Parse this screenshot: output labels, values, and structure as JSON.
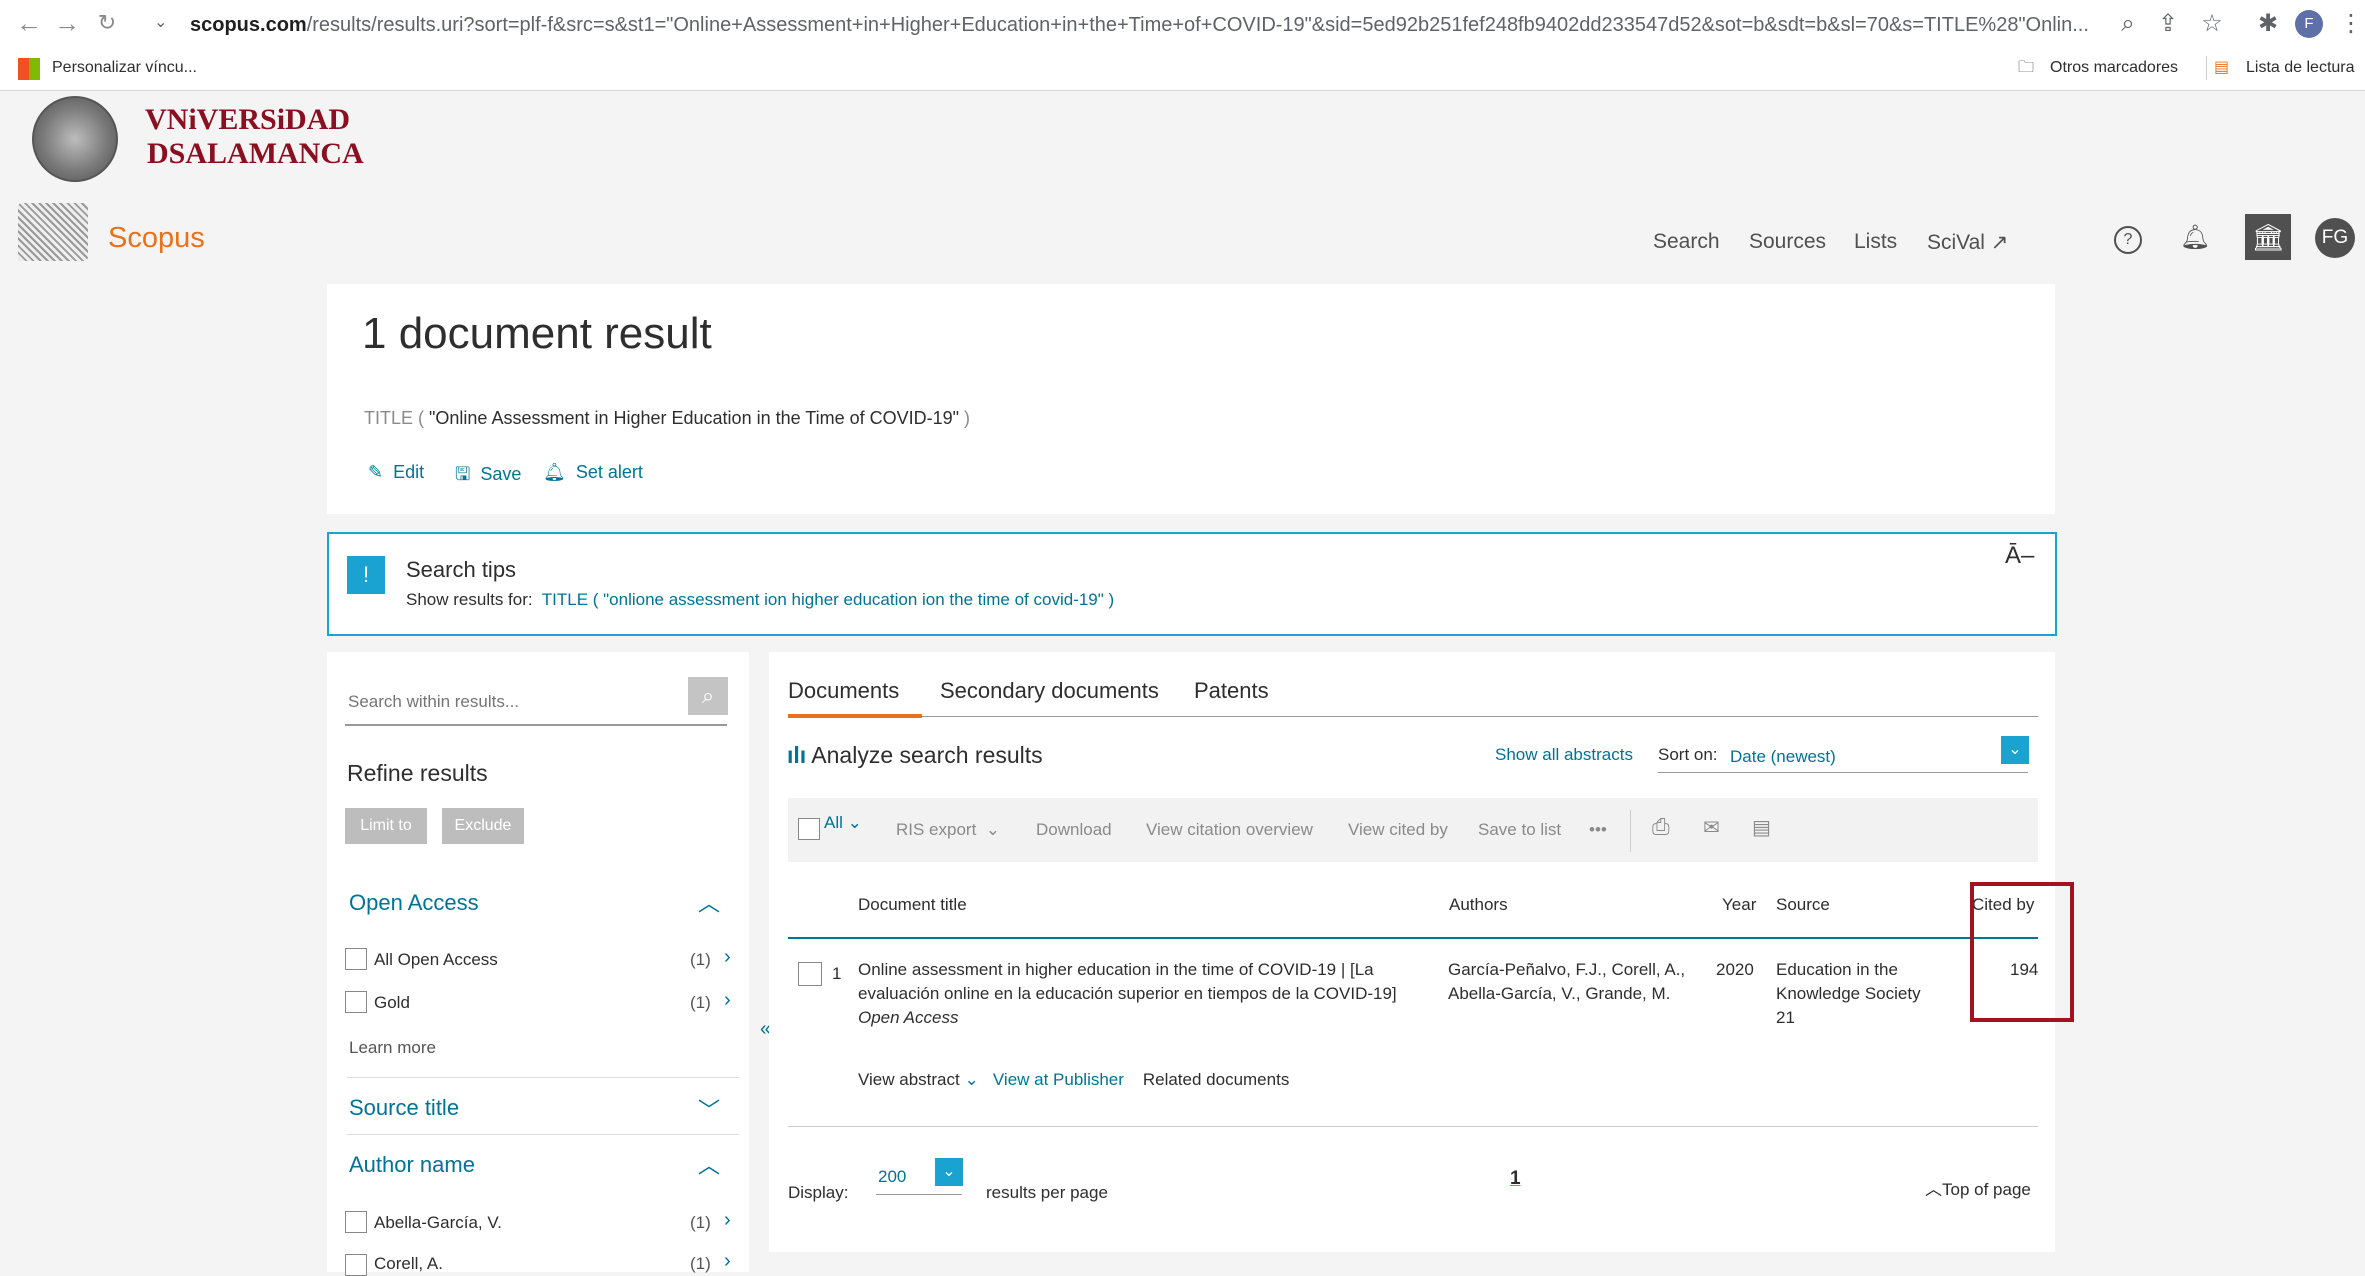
{
  "browser": {
    "url_host": "scopus.com",
    "url_rest": "/results/results.uri?sort=plf-f&src=s&st1=\"Online+Assessment+in+Higher+Education+in+the+Time+of+COVID-19\"&sid=5ed92b251fef248fb9402dd233547d52&sot=b&sdt=b&sl=70&s=TITLE%28\"Onlin...",
    "bookmark_left": "Personalizar víncu...",
    "bookmark_other": "Otros marcadores",
    "bookmark_reading": "Lista de lectura",
    "profile_initial": "F"
  },
  "university": {
    "line1": "VNiVERSiDAD",
    "line2": "DSALAMANCA"
  },
  "scopus": {
    "logo": "Scopus",
    "nav": [
      "Search",
      "Sources",
      "Lists",
      "SciVal ↗"
    ],
    "user_initials": "FG"
  },
  "header": {
    "result_count": "1 document result",
    "query_prefix": "TITLE ( ",
    "query_value": "\"Online Assessment in Higher Education in the Time of COVID-19\"",
    "query_suffix": " )",
    "edit": "Edit",
    "save": "Save",
    "set_alert": "Set alert"
  },
  "tips": {
    "badge": "!",
    "title": "Search tips",
    "show_for": "Show results for:",
    "suggestion": "TITLE ( \"onlione assessment ion higher education ion the time of covid-19\" )",
    "collapse": "Ā–"
  },
  "refine": {
    "search_placeholder": "Search within results...",
    "title": "Refine results",
    "limit_to": "Limit to",
    "exclude": "Exclude",
    "open_access": {
      "heading": "Open Access",
      "items": [
        {
          "label": "All Open Access",
          "count": "(1)"
        },
        {
          "label": "Gold",
          "count": "(1)"
        }
      ],
      "learn_more": "Learn more"
    },
    "source_title": {
      "heading": "Source title"
    },
    "author_name": {
      "heading": "Author name",
      "items": [
        {
          "label": "Abella-García, V.",
          "count": "(1)"
        },
        {
          "label": "Corell, A.",
          "count": "(1)"
        }
      ]
    }
  },
  "results": {
    "tabs": [
      "Documents",
      "Secondary documents",
      "Patents"
    ],
    "analyze": "Analyze search results",
    "show_all_abstracts": "Show all abstracts",
    "sort_on": "Sort on:",
    "sort_value": "Date (newest)",
    "toolbar": {
      "all": "All",
      "ris_export": "RIS export",
      "download": "Download",
      "view_citation": "View citation overview",
      "view_cited_by": "View cited by",
      "save_to_list": "Save to list",
      "more": "•••"
    },
    "columns": {
      "title": "Document title",
      "authors": "Authors",
      "year": "Year",
      "source": "Source",
      "cited_by": "Cited by"
    },
    "rows": [
      {
        "num": "1",
        "title_line1": "Online assessment in higher education in the time of COVID-19 | [La",
        "title_line2": "evaluación online en la educación superior en tiempos de la COVID-19]",
        "access": "Open Access",
        "authors_line1": "García-Peñalvo, F.J., Corell, A.,",
        "authors_line2": "Abella-García, V., Grande, M.",
        "year": "2020",
        "source_line1": "Education in the",
        "source_line2": "Knowledge Society",
        "source_line3": "21",
        "cited_by": "194",
        "view_abstract": "View abstract",
        "view_publisher": "View at Publisher",
        "related": "Related documents"
      }
    ],
    "display_label": "Display:",
    "display_value": "200",
    "results_per_page": "results per page",
    "page": "1",
    "top_of_page": "Top of page"
  }
}
